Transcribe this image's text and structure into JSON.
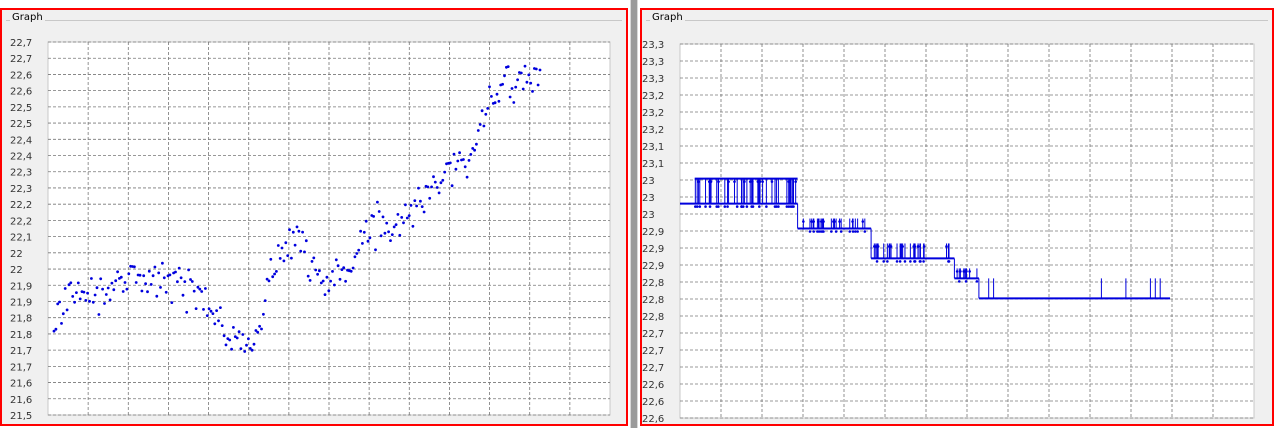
{
  "chart_data": [
    {
      "type": "line",
      "title": "Graph",
      "xlabel": "",
      "ylabel": "",
      "ylim": [
        21.5,
        22.7
      ],
      "grid": true,
      "series_color": "#0000dd",
      "y_tick_labels": [
        "22,7",
        "22,7",
        "22,6",
        "22,6",
        "22,5",
        "22,5",
        "22,4",
        "22,4",
        "22,3",
        "22,3",
        "22,2",
        "22,2",
        "22,1",
        "22",
        "22",
        "21,9",
        "21,9",
        "21,8",
        "21,8",
        "21,7",
        "21,7",
        "21,6",
        "21,6",
        "21,5"
      ],
      "trend_x": [
        0,
        5,
        10,
        15,
        20,
        25,
        30,
        35,
        40,
        45,
        50,
        55,
        60,
        65,
        70,
        75,
        80,
        85,
        90,
        95,
        100
      ],
      "trend_y": [
        21.82,
        21.9,
        21.88,
        21.93,
        21.92,
        21.96,
        21.88,
        21.78,
        21.72,
        21.97,
        22.08,
        21.9,
        21.98,
        22.12,
        22.08,
        22.18,
        22.28,
        22.3,
        22.55,
        22.58,
        22.56
      ]
    },
    {
      "type": "line",
      "title": "Graph",
      "xlabel": "",
      "ylabel": "",
      "ylim": [
        22.6,
        23.35
      ],
      "grid": true,
      "series_color": "#0000dd",
      "y_tick_labels": [
        "23,3",
        "23,3",
        "23,3",
        "23,2",
        "23,2",
        "23,2",
        "23,1",
        "23,1",
        "23",
        "23",
        "23",
        "22,9",
        "22,9",
        "22,9",
        "22,8",
        "22,8",
        "22,8",
        "22,7",
        "22,7",
        "22,7",
        "22,6",
        "22,6",
        "22,6"
      ],
      "steps": [
        {
          "x0": 0,
          "x1": 24,
          "y": 23.03,
          "hi": 23.08
        },
        {
          "x0": 24,
          "x1": 39,
          "y": 22.98,
          "hi": 23.0
        },
        {
          "x0": 39,
          "x1": 56,
          "y": 22.92,
          "hi": 22.95
        },
        {
          "x0": 56,
          "x1": 61,
          "y": 22.88,
          "hi": 22.9
        },
        {
          "x0": 61,
          "x1": 100,
          "y": 22.84,
          "hi": 22.88
        }
      ]
    }
  ]
}
